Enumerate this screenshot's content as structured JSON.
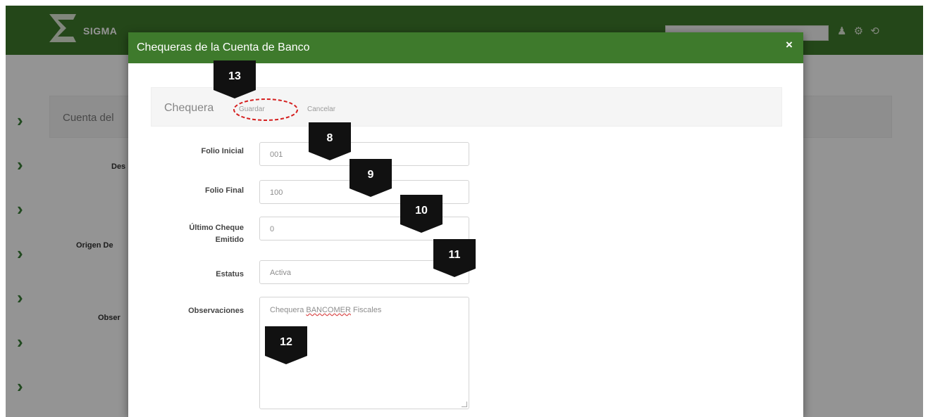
{
  "app": {
    "brand": "SIGMA",
    "nav_icons": "♟ ⚙ ⟲",
    "panel_title": "Cuenta del",
    "bg_labels": [
      "Des",
      "Origen De",
      "Obser"
    ]
  },
  "modal": {
    "title": "Chequeras de la Cuenta de Banco",
    "close_label": "×",
    "toolbar": {
      "title": "Chequera",
      "save_label": "Guardar",
      "cancel_label": "Cancelar"
    },
    "fields": {
      "folio_inicial": {
        "label": "Folio Inicial",
        "value": "001"
      },
      "folio_final": {
        "label": "Folio Final",
        "value": "100"
      },
      "ultimo_cheque": {
        "label_line1": "Último Cheque",
        "label_line2": "Emitido",
        "value": "0"
      },
      "estatus": {
        "label": "Estatus",
        "value": "Activa"
      },
      "observaciones": {
        "label": "Observaciones",
        "value_prefix": "Chequera ",
        "value_misspelled": "BANCOMER",
        "value_suffix": " Fiscales"
      }
    }
  },
  "markers": [
    "13",
    "8",
    "9",
    "10",
    "11",
    "12"
  ],
  "colors": {
    "header_green": "#3e7a2c",
    "sidebar_arrow": "#3a7f37",
    "marker_black": "#111111",
    "highlight_red": "#d51f1f"
  }
}
